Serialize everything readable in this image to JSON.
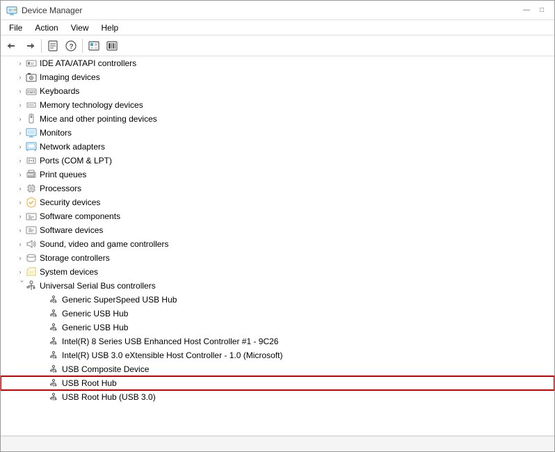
{
  "window": {
    "title": "Device Manager",
    "minimize_label": "—",
    "maximize_label": "□",
    "close_label": "✕"
  },
  "menu": {
    "items": [
      "File",
      "Action",
      "View",
      "Help"
    ]
  },
  "toolbar": {
    "buttons": [
      "back",
      "forward",
      "up",
      "properties",
      "help",
      "show-hidden",
      "scan"
    ]
  },
  "tree": {
    "items": [
      {
        "id": "ide",
        "label": "IDE ATA/ATAPI controllers",
        "indent": 1,
        "expanded": false,
        "icon": "chip"
      },
      {
        "id": "imaging",
        "label": "Imaging devices",
        "indent": 1,
        "expanded": false,
        "icon": "camera"
      },
      {
        "id": "keyboards",
        "label": "Keyboards",
        "indent": 1,
        "expanded": false,
        "icon": "keyboard"
      },
      {
        "id": "memory",
        "label": "Memory technology devices",
        "indent": 1,
        "expanded": false,
        "icon": "chip"
      },
      {
        "id": "mice",
        "label": "Mice and other pointing devices",
        "indent": 1,
        "expanded": false,
        "icon": "mouse"
      },
      {
        "id": "monitors",
        "label": "Monitors",
        "indent": 1,
        "expanded": false,
        "icon": "monitor"
      },
      {
        "id": "network",
        "label": "Network adapters",
        "indent": 1,
        "expanded": false,
        "icon": "network"
      },
      {
        "id": "ports",
        "label": "Ports (COM & LPT)",
        "indent": 1,
        "expanded": false,
        "icon": "ports"
      },
      {
        "id": "printq",
        "label": "Print queues",
        "indent": 1,
        "expanded": false,
        "icon": "print"
      },
      {
        "id": "processors",
        "label": "Processors",
        "indent": 1,
        "expanded": false,
        "icon": "processor"
      },
      {
        "id": "security",
        "label": "Security devices",
        "indent": 1,
        "expanded": false,
        "icon": "security"
      },
      {
        "id": "softcomp",
        "label": "Software components",
        "indent": 1,
        "expanded": false,
        "icon": "software"
      },
      {
        "id": "softdev",
        "label": "Software devices",
        "indent": 1,
        "expanded": false,
        "icon": "software"
      },
      {
        "id": "sound",
        "label": "Sound, video and game controllers",
        "indent": 1,
        "expanded": false,
        "icon": "sound"
      },
      {
        "id": "storage",
        "label": "Storage controllers",
        "indent": 1,
        "expanded": false,
        "icon": "storage"
      },
      {
        "id": "sysdev",
        "label": "System devices",
        "indent": 1,
        "expanded": false,
        "icon": "folder"
      },
      {
        "id": "usb",
        "label": "Universal Serial Bus controllers",
        "indent": 1,
        "expanded": true,
        "icon": "usb"
      },
      {
        "id": "usb-generic-ss",
        "label": "Generic SuperSpeed USB Hub",
        "indent": 2,
        "expanded": false,
        "icon": "usb-device"
      },
      {
        "id": "usb-generic1",
        "label": "Generic USB Hub",
        "indent": 2,
        "expanded": false,
        "icon": "usb-device"
      },
      {
        "id": "usb-generic2",
        "label": "Generic USB Hub",
        "indent": 2,
        "expanded": false,
        "icon": "usb-device"
      },
      {
        "id": "usb-intel8",
        "label": "Intel(R) 8 Series USB Enhanced Host Controller #1 - 9C26",
        "indent": 2,
        "expanded": false,
        "icon": "usb-device"
      },
      {
        "id": "usb-intel3",
        "label": "Intel(R) USB 3.0 eXtensible Host Controller - 1.0 (Microsoft)",
        "indent": 2,
        "expanded": false,
        "icon": "usb-device"
      },
      {
        "id": "usb-composite",
        "label": "USB Composite Device",
        "indent": 2,
        "expanded": false,
        "icon": "usb-device"
      },
      {
        "id": "usb-root",
        "label": "USB Root Hub",
        "indent": 2,
        "expanded": false,
        "icon": "usb-device",
        "highlighted": true
      },
      {
        "id": "usb-root3",
        "label": "USB Root Hub (USB 3.0)",
        "indent": 2,
        "expanded": false,
        "icon": "usb-device"
      }
    ]
  },
  "status_bar": {
    "text": ""
  }
}
